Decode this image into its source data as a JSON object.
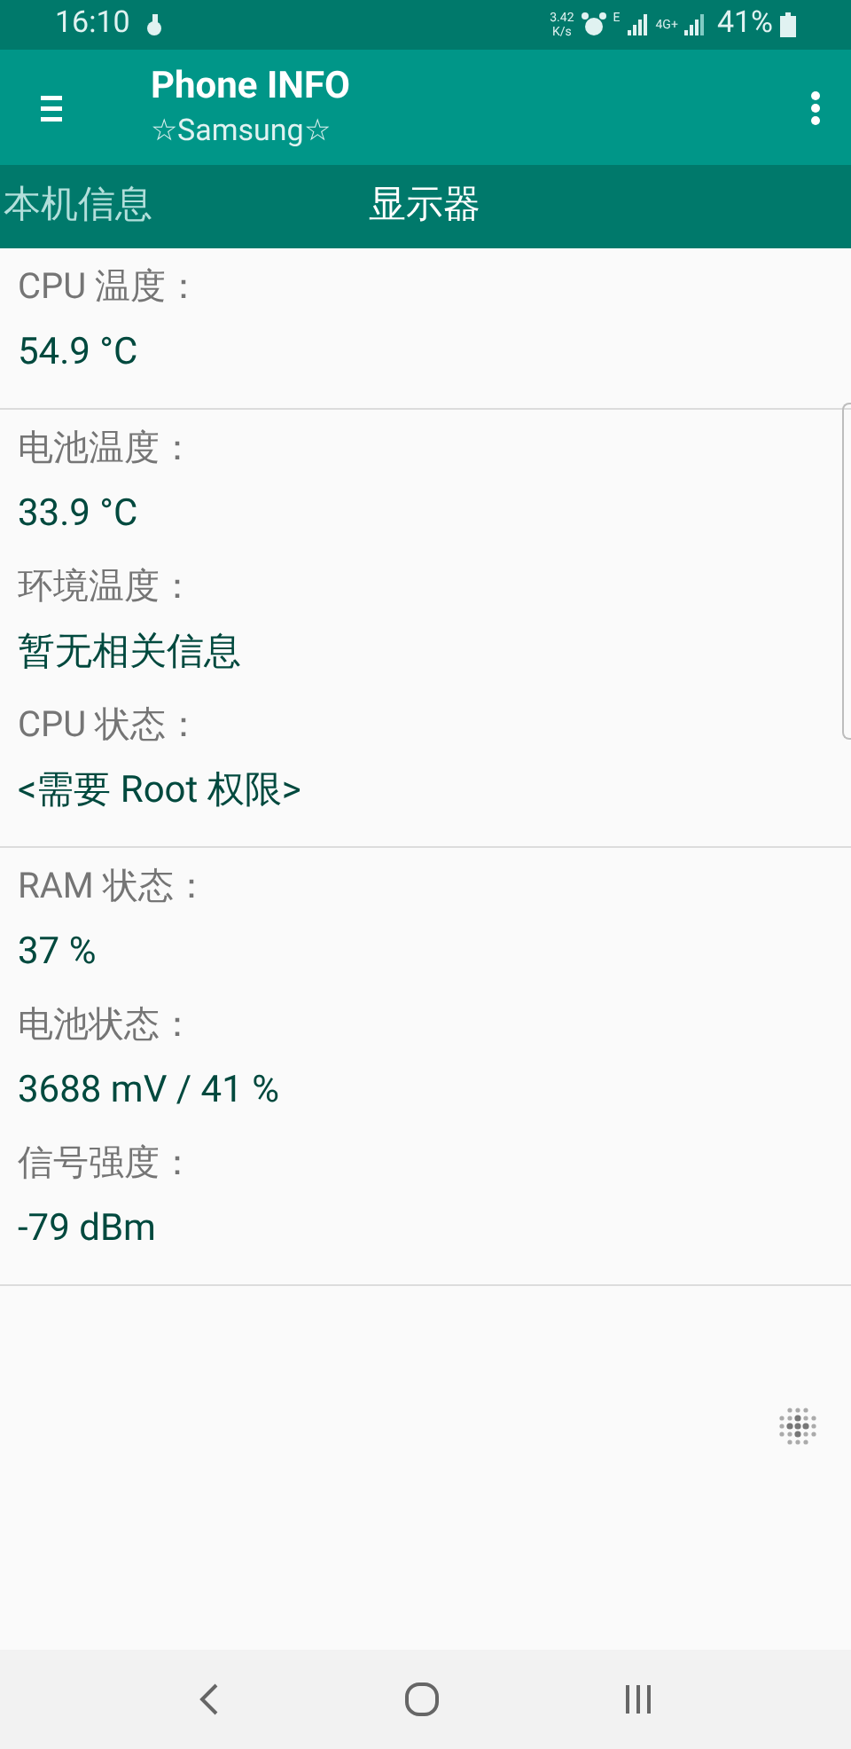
{
  "status_bar": {
    "time": "16:10",
    "speed": "3.42",
    "speed_unit": "K/s",
    "network": "E",
    "network2": "4G+",
    "battery": "41%"
  },
  "app_bar": {
    "title": "Phone INFO",
    "subtitle": "☆Samsung☆"
  },
  "tabs": [
    {
      "label": "本机信息"
    },
    {
      "label": "显示器"
    }
  ],
  "groups": [
    {
      "items": [
        {
          "label": "CPU 温度：",
          "value": "54.9 °C"
        }
      ]
    },
    {
      "items": [
        {
          "label": "电池温度：",
          "value": "33.9 °C"
        },
        {
          "label": "环境温度：",
          "value": "暂无相关信息"
        },
        {
          "label": "CPU 状态：",
          "value": "<需要 Root 权限>"
        }
      ]
    },
    {
      "items": [
        {
          "label": "RAM 状态：",
          "value": "37 %"
        },
        {
          "label": "电池状态：",
          "value": "3688 mV / 41 %"
        },
        {
          "label": "信号强度：",
          "value": "-79 dBm"
        }
      ]
    }
  ]
}
